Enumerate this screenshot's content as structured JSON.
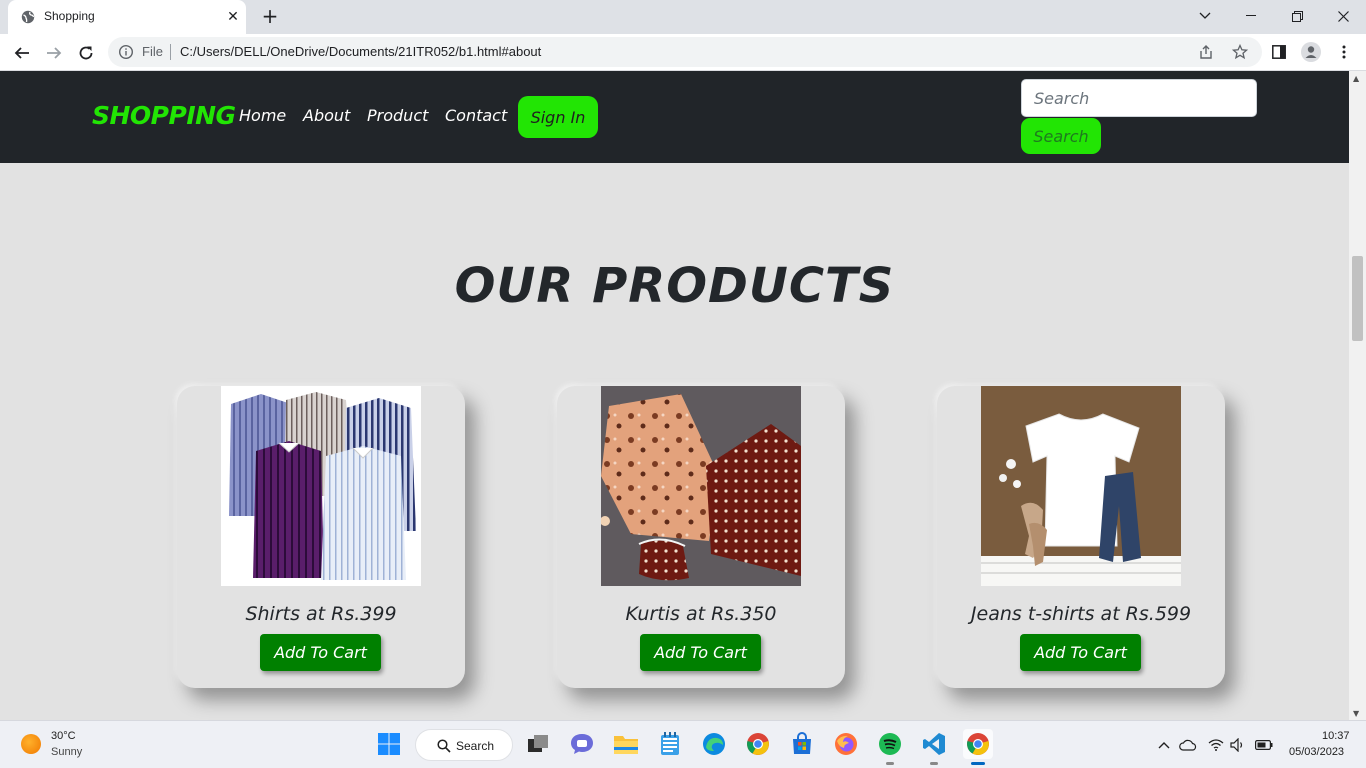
{
  "browser": {
    "tab_title": "Shopping",
    "tab_close": "✕",
    "new_tab": "+",
    "url_scheme_label": "File",
    "url": "C:/Users/DELL/OneDrive/Documents/21ITR052/b1.html#about"
  },
  "site": {
    "brand": "SHOPPING",
    "nav": [
      "Home",
      "About",
      "Product",
      "Contact"
    ],
    "signin_label": "Sign In",
    "search_placeholder": "Search",
    "search_button": "Search"
  },
  "products_section": {
    "title": "OUR PRODUCTS",
    "cards": [
      {
        "label": "Shirts at Rs.399",
        "button": "Add To Cart"
      },
      {
        "label": "Kurtis at Rs.350",
        "button": "Add To Cart"
      },
      {
        "label": "Jeans t-shirts at Rs.599",
        "button": "Add To Cart"
      }
    ]
  },
  "taskbar": {
    "weather_temp": "30°C",
    "weather_condition": "Sunny",
    "search_label": "Search",
    "time": "10:37",
    "date": "05/03/2023"
  },
  "colors": {
    "brand_green": "#22e504",
    "cart_green": "#008000",
    "navbar_bg": "#212529",
    "page_bg": "#e2e2e2"
  }
}
